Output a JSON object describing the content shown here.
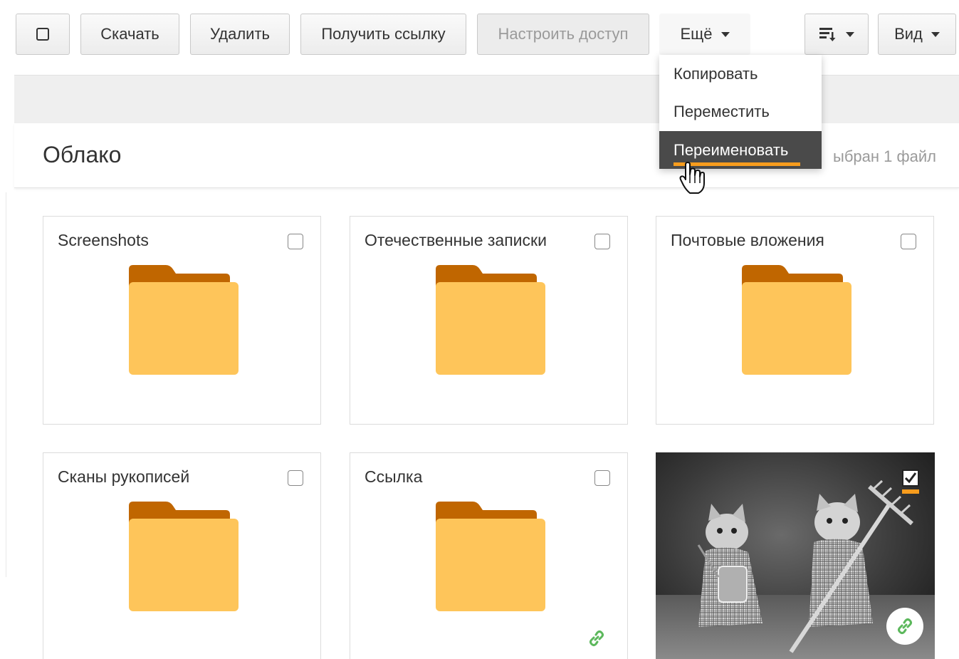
{
  "toolbar": {
    "select_all_aria": "select-all",
    "download": "Скачать",
    "delete": "Удалить",
    "get_link": "Получить ссылку",
    "configure_access": "Настроить доступ",
    "more": "Ещё",
    "sort_icon": "sort-icon",
    "view": "Вид"
  },
  "more_menu": {
    "items": [
      {
        "label": "Копировать"
      },
      {
        "label": "Переместить"
      },
      {
        "label": "Переименовать",
        "active": true
      }
    ]
  },
  "header": {
    "title": "Облако",
    "selection_status": "ыбран 1 файл"
  },
  "items": [
    {
      "name": "Screenshots",
      "type": "folder",
      "checked": false
    },
    {
      "name": "Отечественные записки",
      "type": "folder",
      "checked": false
    },
    {
      "name": "Почтовые вложения",
      "type": "folder",
      "checked": false
    },
    {
      "name": "Сканы рукописей",
      "type": "folder",
      "checked": false
    },
    {
      "name": "Ссылка",
      "type": "folder",
      "checked": false,
      "shared_link": true
    },
    {
      "name": "",
      "type": "image",
      "checked": true,
      "shared_link": true
    }
  ],
  "colors": {
    "folder_back": "#c06600",
    "folder_front": "#fec55a",
    "accent": "#f79c1d",
    "link_green": "#5cb85c",
    "menu_active": "#4a4a4a"
  }
}
